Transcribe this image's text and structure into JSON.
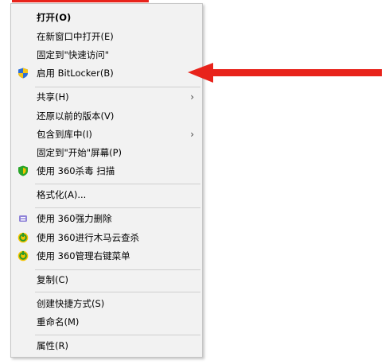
{
  "menu": {
    "items": [
      {
        "label": "打开(O)",
        "bold": true,
        "icon": null,
        "submenu": false
      },
      {
        "label": "在新窗口中打开(E)",
        "icon": null,
        "submenu": false
      },
      {
        "label": "固定到\"快速访问\"",
        "icon": null,
        "submenu": false
      },
      {
        "label": "启用 BitLocker(B)",
        "icon": "shield-icon",
        "submenu": false
      },
      {
        "label": "共享(H)",
        "icon": null,
        "submenu": true
      },
      {
        "label": "还原以前的版本(V)",
        "icon": null,
        "submenu": false
      },
      {
        "label": "包含到库中(I)",
        "icon": null,
        "submenu": true
      },
      {
        "label": "固定到\"开始\"屏幕(P)",
        "icon": null,
        "submenu": false
      },
      {
        "label": "使用 360杀毒 扫描",
        "icon": "360-antivirus-icon",
        "submenu": false
      },
      {
        "label": "格式化(A)...",
        "icon": null,
        "submenu": false
      },
      {
        "label": "使用 360强力删除",
        "icon": "360-force-delete-icon",
        "submenu": false
      },
      {
        "label": "使用 360进行木马云查杀",
        "icon": "360-trojan-scan-icon",
        "submenu": false
      },
      {
        "label": "使用 360管理右键菜单",
        "icon": "360-menu-manager-icon",
        "submenu": false
      },
      {
        "label": "复制(C)",
        "icon": null,
        "submenu": false
      },
      {
        "label": "创建快捷方式(S)",
        "icon": null,
        "submenu": false
      },
      {
        "label": "重命名(M)",
        "icon": null,
        "submenu": false
      },
      {
        "label": "属性(R)",
        "icon": null,
        "submenu": false
      }
    ],
    "submenu_glyph": "›"
  },
  "colors": {
    "annotation_red": "#e8231b",
    "menu_bg": "#f2f2f2"
  }
}
